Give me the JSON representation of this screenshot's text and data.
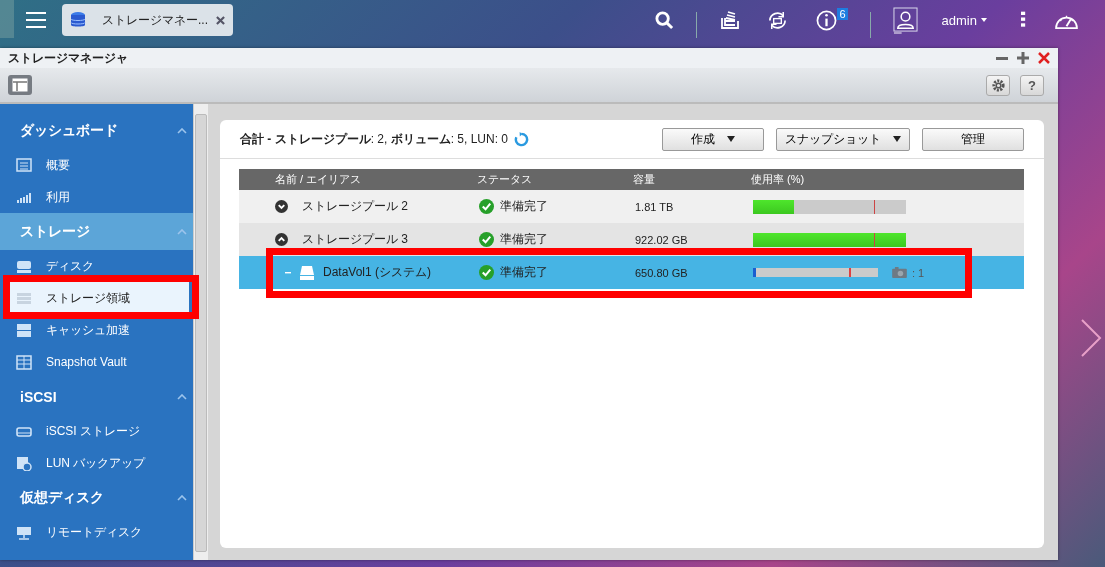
{
  "topbar": {
    "tab": {
      "title": "ストレージマネー...",
      "selected": true
    },
    "notification_count": "6",
    "user": "admin"
  },
  "window": {
    "title": "ストレージマネージャ"
  },
  "sidebar": {
    "sections": [
      {
        "label": "ダッシュボード",
        "selected": false,
        "expanded": true,
        "items": [
          {
            "label": "概要",
            "selected": false
          },
          {
            "label": "利用",
            "selected": false
          }
        ]
      },
      {
        "label": "ストレージ",
        "selected": true,
        "expanded": true,
        "items": [
          {
            "label": "ディスク",
            "selected": false
          },
          {
            "label": "ストレージ領域",
            "selected": true
          },
          {
            "label": "キャッシュ加速",
            "selected": false
          },
          {
            "label": "Snapshot Vault",
            "selected": false
          }
        ]
      },
      {
        "label": "iSCSI",
        "selected": false,
        "expanded": true,
        "items": [
          {
            "label": "iSCSI ストレージ",
            "selected": false
          },
          {
            "label": "LUN バックアップ",
            "selected": false
          }
        ]
      },
      {
        "label": "仮想ディスク",
        "selected": false,
        "expanded": true,
        "items": [
          {
            "label": "リモートディスク",
            "selected": false
          }
        ]
      }
    ]
  },
  "toolbar": {
    "help_label": "?"
  },
  "summary": "**合計 - ストレージプール**: 2, **ボリューム**: 5, LUN: 0",
  "buttons": [
    {
      "label": "作成",
      "dropdown": true
    },
    {
      "label": "スナップショット",
      "dropdown": true
    },
    {
      "label": "管理",
      "dropdown": false
    }
  ],
  "table": {
    "columns": [
      "名前 / エイリアス",
      "ステータス",
      "容量",
      "使用率 (%)"
    ],
    "rows": [
      {
        "kind": "pool",
        "name": "ストレージプール 2",
        "expanded": false,
        "selected": false,
        "status": "準備完了",
        "capacity": "1.81 TB",
        "level": 0.27
      },
      {
        "kind": "pool",
        "name": "ストレージプール 3",
        "expanded": true,
        "selected": false,
        "status": "準備完了",
        "capacity": "922.02 GB",
        "level": 1.0,
        "children": [
          {
            "kind": "volume",
            "name": "DataVol1 (システム)",
            "selected": true,
            "status": "準備完了",
            "capacity": "650.80 GB",
            "level": 0.02,
            "snapshots": ": 1"
          }
        ]
      }
    ]
  }
}
